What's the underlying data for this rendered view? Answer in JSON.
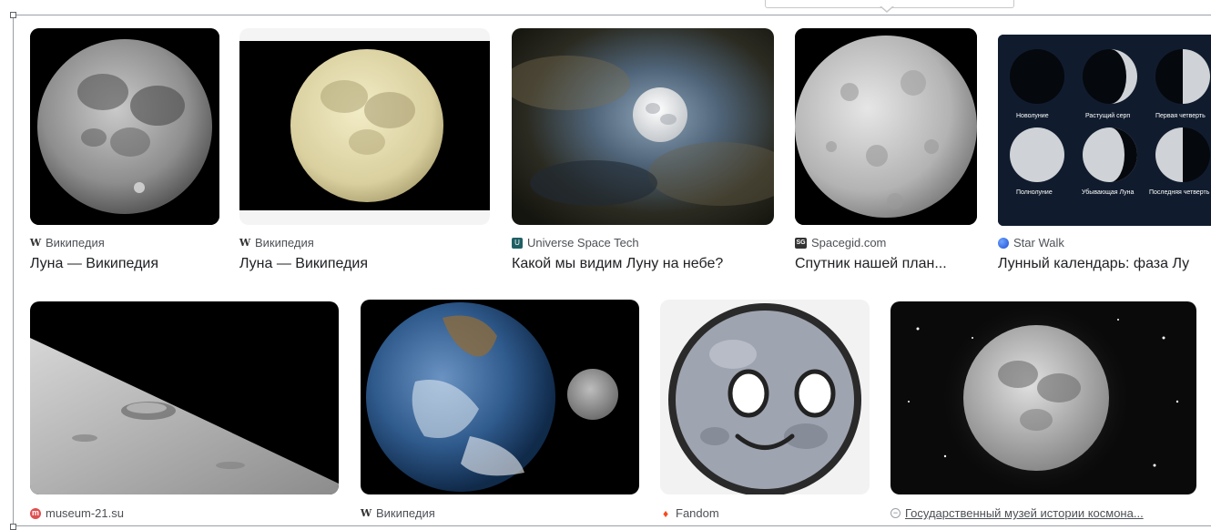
{
  "results": {
    "row1": [
      {
        "source": "Википедия",
        "favicon": "wikipedia-icon",
        "title": "Луна — Википедия"
      },
      {
        "source": "Википедия",
        "favicon": "wikipedia-icon",
        "title": "Луна — Википедия"
      },
      {
        "source": "Universe Space Tech",
        "favicon": "universe-space-tech-icon",
        "title": "Какой мы видим Луну на небе?"
      },
      {
        "source": "Spacegid.com",
        "favicon": "spacegid-icon",
        "title": "Спутник нашей план..."
      },
      {
        "source": "Star Walk",
        "favicon": "star-walk-globe-icon",
        "title": "Лунный календарь: фаза Лу"
      }
    ],
    "row2": [
      {
        "source": "museum-21.su",
        "favicon": "museum-21-icon"
      },
      {
        "source": "Википедия",
        "favicon": "wikipedia-icon"
      },
      {
        "source": "Fandom",
        "favicon": "fandom-flame-icon"
      },
      {
        "source": "Государственный музей истории космона...",
        "favicon": "minus-circle-icon"
      }
    ]
  },
  "phases": {
    "new": "Новолуние",
    "waxing_crescent": "Растущий серп",
    "first_quarter": "Первая четверть",
    "full": "Полнолуние",
    "waning": "Убывающая Луна",
    "last_quarter": "Последняя четверть"
  },
  "favicon_glyphs": {
    "wikipedia": "W",
    "universe": "U",
    "spacegid": "SG",
    "museum": "m",
    "fandom": "♦",
    "minus": "−"
  },
  "colors": {
    "source_text": "#4d5156",
    "title_text": "#202124",
    "frame": "#9aa0a6"
  }
}
